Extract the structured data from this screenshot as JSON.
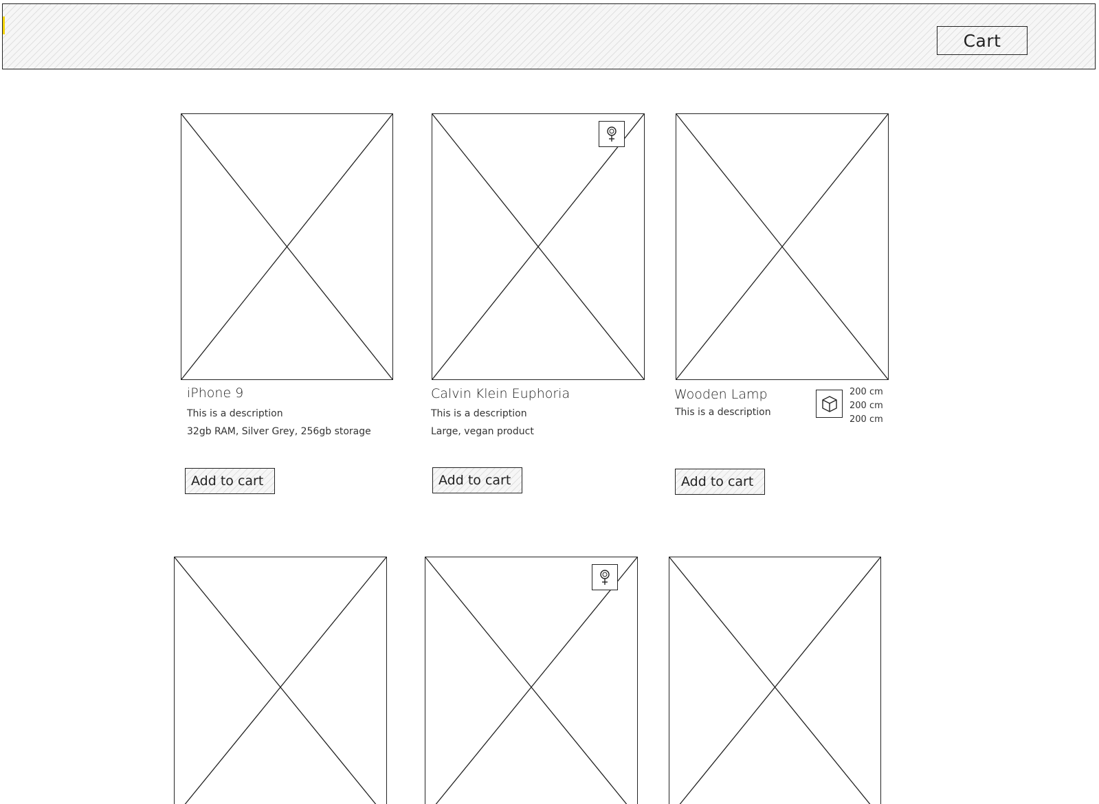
{
  "header": {
    "cart_label": "Cart"
  },
  "products": [
    {
      "name": "iPhone 9",
      "description": "This is a description",
      "details": "32gb RAM, Silver Grey, 256gb storage",
      "button_label": "Add to cart"
    },
    {
      "name": "Calvin Klein Euphoria",
      "description": "This is a description",
      "details": "Large, vegan product",
      "button_label": "Add to cart",
      "badge_icon": "female-icon"
    },
    {
      "name": "Wooden Lamp",
      "description": "This is a description",
      "dimensions": [
        "200 cm",
        "200 cm",
        "200 cm"
      ],
      "button_label": "Add to cart",
      "badge_icon": "box-icon"
    },
    {},
    {
      "badge_icon": "female-icon"
    },
    {}
  ],
  "colors": {
    "stroke": "#222222",
    "accent": "#f5d60a",
    "hatch_bg": "#f6f6f6"
  }
}
